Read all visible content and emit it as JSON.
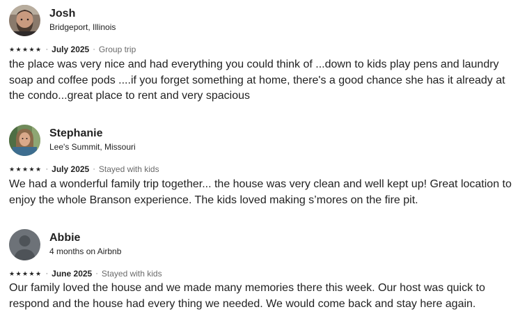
{
  "reviews": [
    {
      "name": "Josh",
      "subtitle": "Bridgeport, Illinois",
      "rating": 5,
      "date": "July 2025",
      "trip_type": "Group trip",
      "text": "the place was very nice and had everything you could think of ...down to kids play pens and laundry soap and coffee pods ....if you forget something at home, there's a good chance she has it already at the condo...great place to rent and very spacious"
    },
    {
      "name": "Stephanie",
      "subtitle": "Lee's Summit, Missouri",
      "rating": 5,
      "date": "July 2025",
      "trip_type": "Stayed with kids",
      "text": "We had a wonderful family trip together... the house was very clean and well kept up! Great location to enjoy the whole Branson experience. The kids loved making s’mores on the fire pit."
    },
    {
      "name": "Abbie",
      "subtitle": "4 months on Airbnb",
      "rating": 5,
      "date": "June 2025",
      "trip_type": "Stayed with kids",
      "text": "Our family loved the house and we made many memories there this week. Our host was quick to respond and the house had every thing we needed. We would come back and stay here again."
    }
  ],
  "separator": "·",
  "star_glyph": "★"
}
